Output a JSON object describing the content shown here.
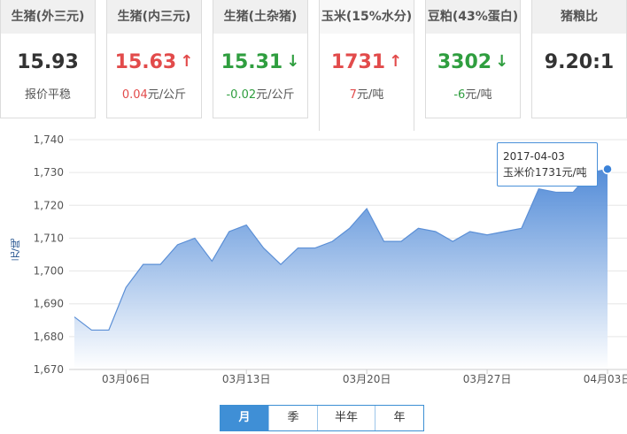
{
  "cards": [
    {
      "title": "生猪(外三元)",
      "price": "15.93",
      "dir": "flat",
      "arrow": "",
      "change_value": "",
      "change_text": "报价平稳"
    },
    {
      "title": "生猪(内三元)",
      "price": "15.63",
      "dir": "up",
      "arrow": "↑",
      "change_value": "0.04",
      "change_text": "元/公斤"
    },
    {
      "title": "生猪(土杂猪)",
      "price": "15.31",
      "dir": "down",
      "arrow": "↓",
      "change_value": "-0.02",
      "change_text": "元/公斤"
    },
    {
      "title": "玉米(15%水分)",
      "price": "1731",
      "dir": "up",
      "arrow": "↑",
      "change_value": "7",
      "change_text": "元/吨"
    },
    {
      "title": "豆粕(43%蛋白)",
      "price": "3302",
      "dir": "down",
      "arrow": "↓",
      "change_value": "-6",
      "change_text": "元/吨"
    },
    {
      "title": "猪粮比",
      "price": "9.20:1",
      "dir": "flat",
      "arrow": "",
      "change_value": "",
      "change_text": ""
    }
  ],
  "active_card": 3,
  "tooltip": {
    "date": "2017-04-03",
    "text": "玉米价1731元/吨"
  },
  "period_tabs": [
    "月",
    "季",
    "半年",
    "年"
  ],
  "chart_data": {
    "type": "area",
    "ylabel": "元/吨",
    "ylim": [
      1670,
      1740
    ],
    "yticks": [
      1670,
      1680,
      1690,
      1700,
      1710,
      1720,
      1730,
      1740
    ],
    "ytick_labels": [
      "1,670",
      "1,680",
      "1,690",
      "1,700",
      "1,710",
      "1,720",
      "1,730",
      "1,740"
    ],
    "x": [
      "03-03",
      "03-04",
      "03-05",
      "03-06",
      "03-07",
      "03-08",
      "03-09",
      "03-10",
      "03-11",
      "03-12",
      "03-13",
      "03-14",
      "03-15",
      "03-16",
      "03-17",
      "03-18",
      "03-19",
      "03-20",
      "03-21",
      "03-22",
      "03-23",
      "03-24",
      "03-25",
      "03-26",
      "03-27",
      "03-28",
      "03-29",
      "03-30",
      "03-31",
      "04-01",
      "04-02",
      "04-03"
    ],
    "values": [
      1686,
      1682,
      1682,
      1695,
      1702,
      1702,
      1708,
      1710,
      1703,
      1712,
      1714,
      1707,
      1702,
      1707,
      1707,
      1709,
      1713,
      1719,
      1709,
      1709,
      1713,
      1712,
      1709,
      1712,
      1711,
      1712,
      1713,
      1725,
      1724,
      1724,
      1730,
      1731
    ],
    "xtick_labels": [
      {
        "index": 3,
        "label": "03月06日"
      },
      {
        "index": 10,
        "label": "03月13日"
      },
      {
        "index": 17,
        "label": "03月20日"
      },
      {
        "index": 24,
        "label": "03月27日"
      },
      {
        "index": 31,
        "label": "04月03日"
      }
    ],
    "grid": true,
    "colors": {
      "line": "#5b8fd6",
      "fill_top": "#4a86d6",
      "fill_bottom": "#ffffff",
      "grid": "#e6e6e6",
      "highlight": "#3b82d8"
    }
  }
}
